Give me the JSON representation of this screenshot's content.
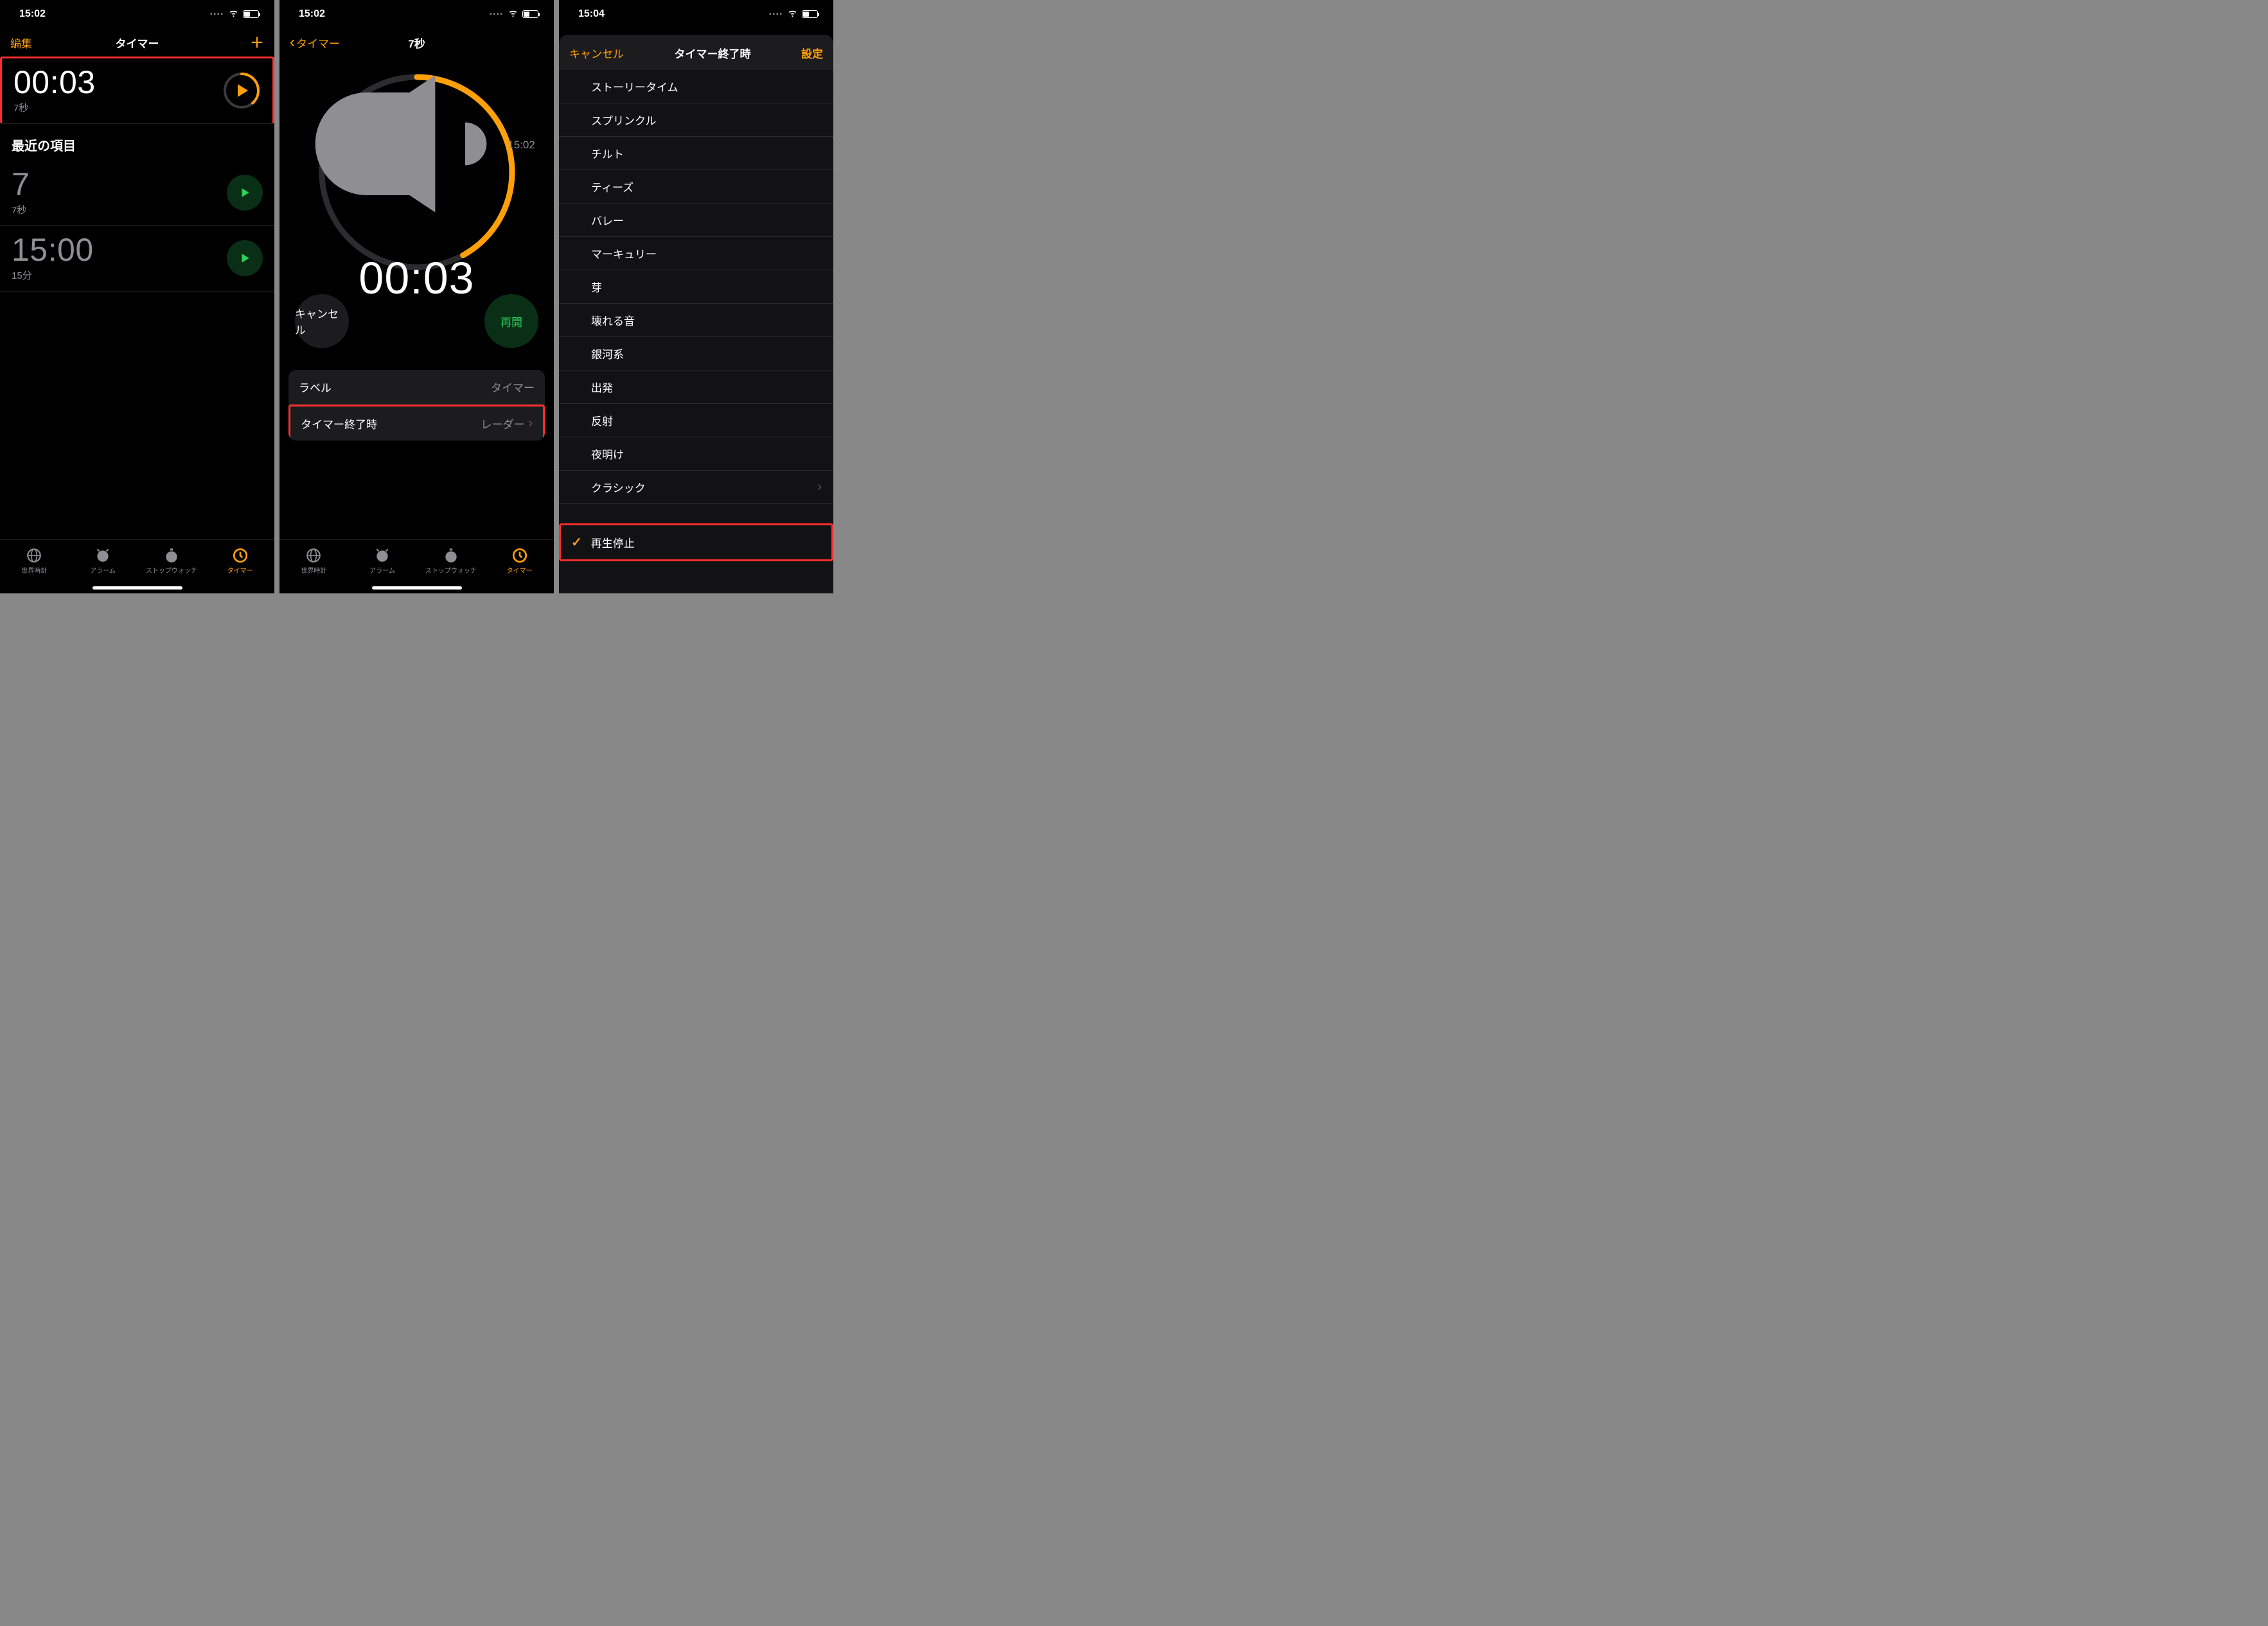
{
  "screen1": {
    "status": {
      "time": "15:02"
    },
    "nav": {
      "edit": "編集",
      "title": "タイマー"
    },
    "activeTimer": {
      "time": "00:03",
      "label": "7秒"
    },
    "recentsHeader": "最近の項目",
    "recents": [
      {
        "time": "7",
        "label": "7秒"
      },
      {
        "time": "15:00",
        "label": "15分"
      }
    ],
    "tabs": {
      "world": "世界時計",
      "alarm": "アラーム",
      "stopwatch": "ストップウォッチ",
      "timer": "タイマー"
    }
  },
  "screen2": {
    "status": {
      "time": "15:02"
    },
    "nav": {
      "back": "タイマー",
      "title": "7秒"
    },
    "circle": {
      "endTime": "15:02",
      "remaining": "00:03"
    },
    "cancel": "キャンセル",
    "resume": "再開",
    "rows": {
      "labelKey": "ラベル",
      "labelValue": "タイマー",
      "soundKey": "タイマー終了時",
      "soundValue": "レーダー"
    },
    "tabs": {
      "world": "世界時計",
      "alarm": "アラーム",
      "stopwatch": "ストップウォッチ",
      "timer": "タイマー"
    }
  },
  "screen3": {
    "status": {
      "time": "15:04"
    },
    "modal": {
      "cancel": "キャンセル",
      "title": "タイマー終了時",
      "done": "設定"
    },
    "sounds": [
      "ストーリータイム",
      "スプリンクル",
      "チルト",
      "ティーズ",
      "バレー",
      "マーキュリー",
      "芽",
      "壊れる音",
      "銀河系",
      "出発",
      "反射",
      "夜明け"
    ],
    "classic": "クラシック",
    "stopPlayback": "再生停止"
  }
}
